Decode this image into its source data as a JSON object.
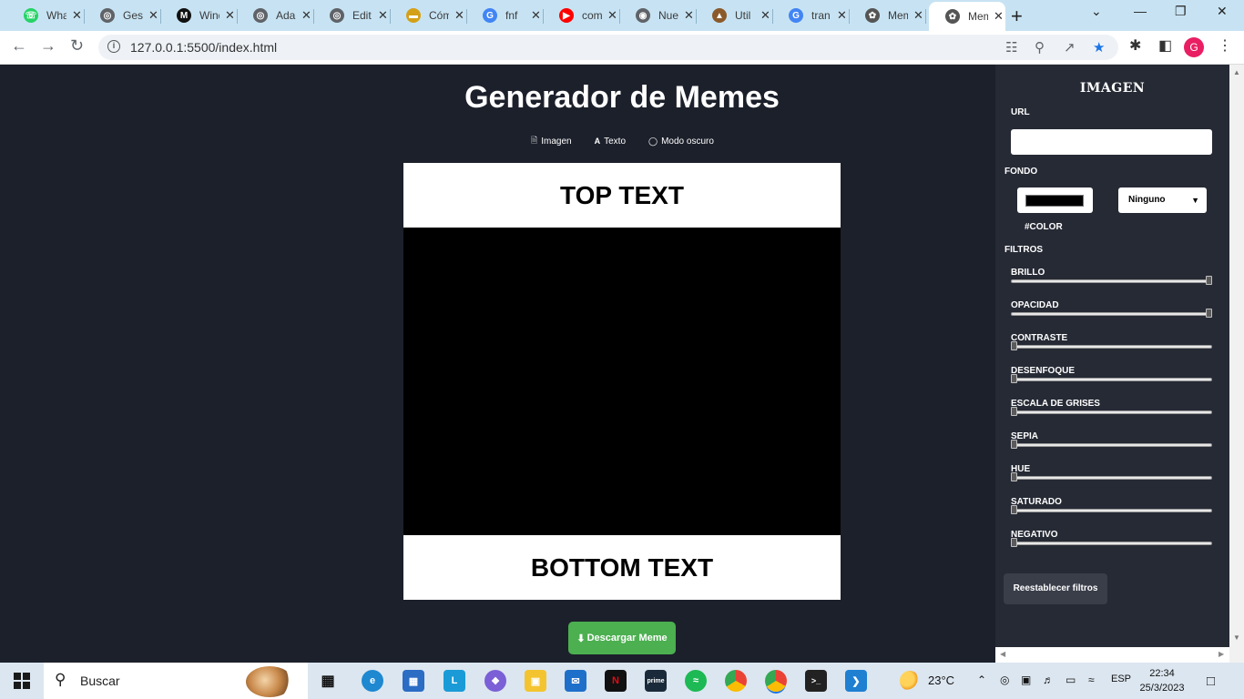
{
  "browser": {
    "tabs": [
      {
        "title": "WhatsApp",
        "icon": "whatsapp-icon",
        "color": "#25d366"
      },
      {
        "title": "Gestor",
        "icon": "globe-icon",
        "color": "#5f6368"
      },
      {
        "title": "Windows",
        "icon": "m-logo-icon",
        "color": "#111111"
      },
      {
        "title": "Ada",
        "icon": "globe-icon",
        "color": "#5f6368"
      },
      {
        "title": "Edit",
        "icon": "globe-icon",
        "color": "#5f6368"
      },
      {
        "title": "Cómo",
        "icon": "folder-icon",
        "color": "#d4a017"
      },
      {
        "title": "fnf",
        "icon": "google-icon",
        "color": "#4285f4"
      },
      {
        "title": "com",
        "icon": "youtube-icon",
        "color": "#ff0000"
      },
      {
        "title": "Nue",
        "icon": "chrome-icon",
        "color": "#5f6368"
      },
      {
        "title": "Util",
        "icon": "hat-icon",
        "color": "#8b5a2b"
      },
      {
        "title": "tran",
        "icon": "google-icon",
        "color": "#4285f4"
      },
      {
        "title": "Mem",
        "icon": "raspberry-icon",
        "color": "#555555"
      },
      {
        "title": "Mem",
        "icon": "raspberry-icon",
        "color": "#555555",
        "active": true
      }
    ],
    "url": "127.0.0.1:5500/index.html",
    "profile_initial": "G"
  },
  "app": {
    "title": "Generador de Memes",
    "nav": {
      "image": "Imagen",
      "text": "Texto",
      "dark_mode": "Modo oscuro"
    },
    "meme": {
      "top_text": "TOP TEXT",
      "bottom_text": "BOTTOM TEXT",
      "image_bg": "#000000"
    },
    "download_label": "Descargar Meme",
    "accent": "#4caf50"
  },
  "panel": {
    "title": "IMAGEN",
    "url_label": "URL",
    "url_value": "",
    "background_label": "FONDO",
    "background_color": "#000000",
    "hex_label": "#COLOR",
    "blend_mode": "Ninguno",
    "filters_label": "FILTROS",
    "filters": [
      {
        "label": "BRILLO",
        "value": 1
      },
      {
        "label": "OPACIDAD",
        "value": 1
      },
      {
        "label": "CONTRASTE",
        "value": 0
      },
      {
        "label": "DESENFOQUE",
        "value": 0
      },
      {
        "label": "ESCALA DE GRISES",
        "value": 0
      },
      {
        "label": "SEPIA",
        "value": 0
      },
      {
        "label": "HUE",
        "value": 0
      },
      {
        "label": "SATURADO",
        "value": 0
      },
      {
        "label": "NEGATIVO",
        "value": 0
      }
    ],
    "reset_label": "Reestablecer filtros"
  },
  "taskbar": {
    "search_placeholder": "Buscar",
    "temperature": "23°C",
    "language": "ESP",
    "time": "22:34",
    "date": "25/3/2023"
  }
}
